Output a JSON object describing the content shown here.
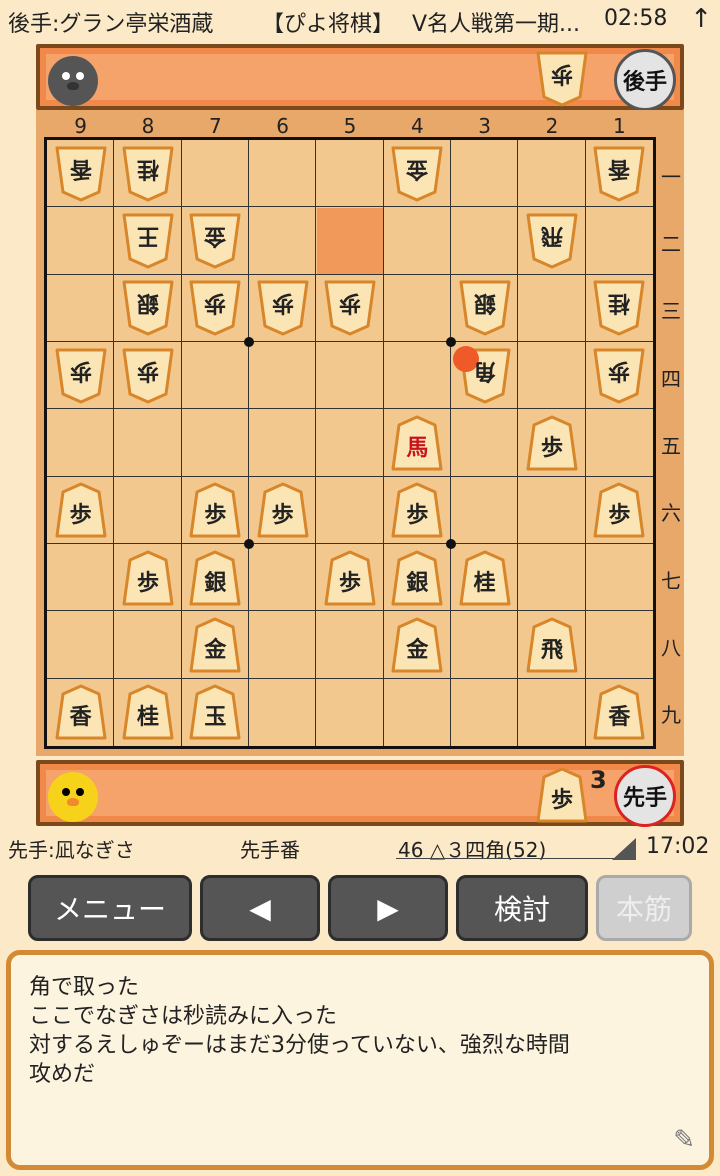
{
  "header": {
    "gote_player": "後手:グラン亭栄酒蔵",
    "app_name": "【ぴよ将棋】",
    "game_title": "V名人戦第一期...",
    "clock": "02:58",
    "up_icon": "up-arrow-icon"
  },
  "gote_stand": {
    "badge": "後手",
    "pieces": [
      {
        "char": "歩",
        "count": ""
      }
    ]
  },
  "sente_stand": {
    "badge": "先手",
    "pieces": [
      {
        "char": "歩",
        "count": "3"
      }
    ]
  },
  "board": {
    "files": [
      "9",
      "8",
      "7",
      "6",
      "5",
      "4",
      "3",
      "2",
      "1"
    ],
    "ranks": [
      "一",
      "二",
      "三",
      "四",
      "五",
      "六",
      "七",
      "八",
      "九"
    ],
    "highlight_square": {
      "file": 5,
      "rank": 2
    },
    "last_move_marker": {
      "file": 3,
      "rank": 4
    },
    "pieces": [
      {
        "file": 9,
        "rank": 1,
        "char": "香",
        "owner": "gote",
        "promoted": false
      },
      {
        "file": 8,
        "rank": 1,
        "char": "桂",
        "owner": "gote",
        "promoted": false
      },
      {
        "file": 4,
        "rank": 1,
        "char": "金",
        "owner": "gote",
        "promoted": false
      },
      {
        "file": 1,
        "rank": 1,
        "char": "香",
        "owner": "gote",
        "promoted": false
      },
      {
        "file": 8,
        "rank": 2,
        "char": "王",
        "owner": "gote",
        "promoted": false
      },
      {
        "file": 7,
        "rank": 2,
        "char": "金",
        "owner": "gote",
        "promoted": false
      },
      {
        "file": 2,
        "rank": 2,
        "char": "飛",
        "owner": "gote",
        "promoted": false
      },
      {
        "file": 8,
        "rank": 3,
        "char": "銀",
        "owner": "gote",
        "promoted": false
      },
      {
        "file": 7,
        "rank": 3,
        "char": "歩",
        "owner": "gote",
        "promoted": false
      },
      {
        "file": 6,
        "rank": 3,
        "char": "歩",
        "owner": "gote",
        "promoted": false
      },
      {
        "file": 5,
        "rank": 3,
        "char": "歩",
        "owner": "gote",
        "promoted": false
      },
      {
        "file": 3,
        "rank": 3,
        "char": "銀",
        "owner": "gote",
        "promoted": false
      },
      {
        "file": 1,
        "rank": 3,
        "char": "桂",
        "owner": "gote",
        "promoted": false
      },
      {
        "file": 9,
        "rank": 4,
        "char": "歩",
        "owner": "gote",
        "promoted": false
      },
      {
        "file": 8,
        "rank": 4,
        "char": "歩",
        "owner": "gote",
        "promoted": false
      },
      {
        "file": 3,
        "rank": 4,
        "char": "角",
        "owner": "gote",
        "promoted": false
      },
      {
        "file": 1,
        "rank": 4,
        "char": "歩",
        "owner": "gote",
        "promoted": false
      },
      {
        "file": 4,
        "rank": 5,
        "char": "馬",
        "owner": "sente",
        "promoted": true
      },
      {
        "file": 2,
        "rank": 5,
        "char": "歩",
        "owner": "sente",
        "promoted": false
      },
      {
        "file": 9,
        "rank": 6,
        "char": "歩",
        "owner": "sente",
        "promoted": false
      },
      {
        "file": 7,
        "rank": 6,
        "char": "歩",
        "owner": "sente",
        "promoted": false
      },
      {
        "file": 6,
        "rank": 6,
        "char": "歩",
        "owner": "sente",
        "promoted": false
      },
      {
        "file": 4,
        "rank": 6,
        "char": "歩",
        "owner": "sente",
        "promoted": false
      },
      {
        "file": 1,
        "rank": 6,
        "char": "歩",
        "owner": "sente",
        "promoted": false
      },
      {
        "file": 8,
        "rank": 7,
        "char": "歩",
        "owner": "sente",
        "promoted": false
      },
      {
        "file": 7,
        "rank": 7,
        "char": "銀",
        "owner": "sente",
        "promoted": false
      },
      {
        "file": 5,
        "rank": 7,
        "char": "歩",
        "owner": "sente",
        "promoted": false
      },
      {
        "file": 4,
        "rank": 7,
        "char": "銀",
        "owner": "sente",
        "promoted": false
      },
      {
        "file": 3,
        "rank": 7,
        "char": "桂",
        "owner": "sente",
        "promoted": false
      },
      {
        "file": 7,
        "rank": 8,
        "char": "金",
        "owner": "sente",
        "promoted": false
      },
      {
        "file": 4,
        "rank": 8,
        "char": "金",
        "owner": "sente",
        "promoted": false
      },
      {
        "file": 2,
        "rank": 8,
        "char": "飛",
        "owner": "sente",
        "promoted": false
      },
      {
        "file": 9,
        "rank": 9,
        "char": "香",
        "owner": "sente",
        "promoted": false
      },
      {
        "file": 8,
        "rank": 9,
        "char": "桂",
        "owner": "sente",
        "promoted": false
      },
      {
        "file": 7,
        "rank": 9,
        "char": "玉",
        "owner": "sente",
        "promoted": false
      },
      {
        "file": 1,
        "rank": 9,
        "char": "香",
        "owner": "sente",
        "promoted": false
      }
    ]
  },
  "status": {
    "sente_player": "先手:凪なぎさ",
    "turn": "先手番",
    "last_move": "46 △３四角(52)",
    "time": "17:02"
  },
  "buttons": {
    "menu": "メニュー",
    "prev": "◀",
    "next": "▶",
    "analyze": "検討",
    "mainline": "本筋"
  },
  "comment": {
    "lines": [
      "角で取った",
      "ここでなぎさは秒読みに入った",
      "対するえしゅぞーはまだ3分使っていない、強烈な時間",
      "攻めだ"
    ],
    "edit_icon": "pencil-icon"
  },
  "colors": {
    "board": "#f2c88f",
    "stand": "#f0894a",
    "promoted_text": "#c8141e",
    "highlight": "#f0894a"
  }
}
